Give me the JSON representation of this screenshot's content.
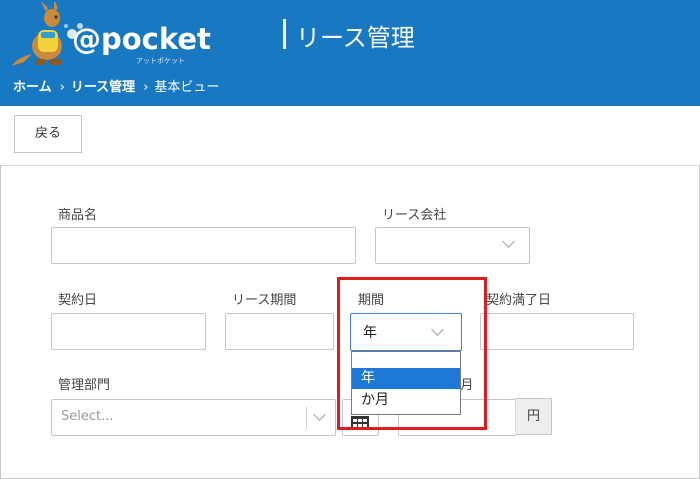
{
  "header": {
    "logo_text": "@pocket",
    "logo_sub": "アットポケット",
    "title": "リース管理",
    "breadcrumb": [
      "ホーム",
      "リース管理",
      "基本ビュー"
    ],
    "breadcrumb_sep": "›"
  },
  "toolbar": {
    "back_label": "戻る"
  },
  "form": {
    "product_name_label": "商品名",
    "lease_company_label": "リース会社",
    "contract_date_label": "契約日",
    "lease_period_label": "リース期間",
    "period_label": "期間",
    "contract_end_label": "契約満了日",
    "department_label": "管理部門",
    "department_placeholder": "Select...",
    "monthly_suffix_label": "/月",
    "yen_label": "円",
    "period_unit": {
      "value": "年",
      "options": [
        "年",
        "か月"
      ],
      "highlighted_option": "年"
    }
  },
  "colors": {
    "header_bg": "#1978c2",
    "highlight_border": "#e01c1c",
    "selected_option_bg": "#1e79d6",
    "focus_border": "#3b7fd6"
  },
  "icons": [
    "kangaroo-logo-icon",
    "chevron-down-icon",
    "calculator-icon"
  ]
}
